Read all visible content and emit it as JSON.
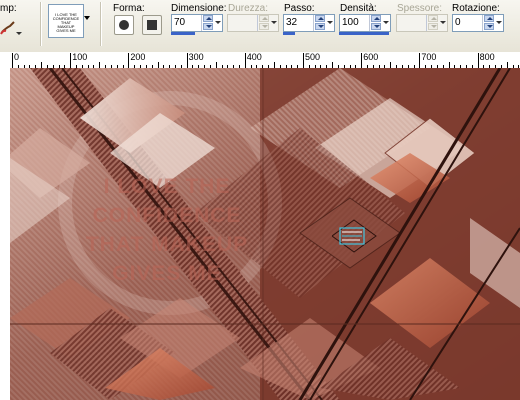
{
  "toolbar": {
    "tool_label": "mp:",
    "preview_text": "I LOVE THE CONFIDENCE THAT MAKEUP GIVES ME",
    "shape_label": "Forma:",
    "size": {
      "label": "Dimensione:",
      "value": "70"
    },
    "hardness": {
      "label": "Durezza:",
      "value": ""
    },
    "step": {
      "label": "Passo:",
      "value": "32"
    },
    "density": {
      "label": "Densità:",
      "value": "100"
    },
    "thickness": {
      "label": "Spessore:",
      "value": ""
    },
    "rotation": {
      "label": "Rotazione:",
      "value": "0"
    }
  },
  "ruler": {
    "labels": [
      "0",
      "100",
      "200",
      "300",
      "400",
      "500",
      "600",
      "700",
      "800"
    ]
  },
  "canvas": {
    "quote_lines": [
      "I LOVE THE",
      "CONFIDENCE",
      "THAT MAKEUP",
      "GIVES ME"
    ],
    "colors": {
      "base": "#7b3a2e",
      "light": "#e8cfc4",
      "accent": "#d9744f"
    }
  }
}
